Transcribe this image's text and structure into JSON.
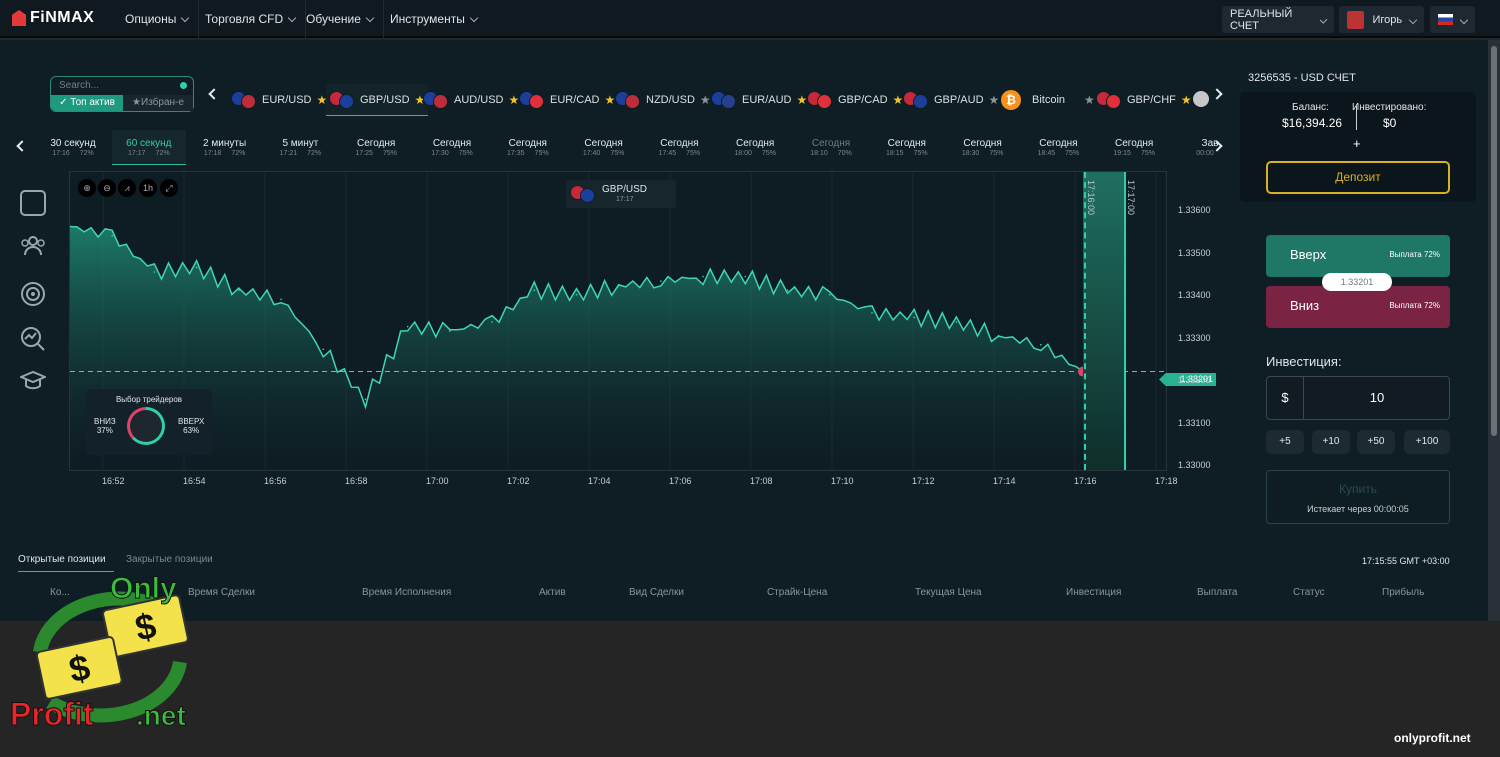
{
  "brand": "FiNMAX",
  "nav": [
    "Опционы",
    "Торговля CFD",
    "Обучение",
    "Инструменты"
  ],
  "account_type": "РЕАЛЬНЫЙ СЧЕТ",
  "user_name": "Игорь",
  "search": {
    "placeholder": "Search...",
    "tab_top": "Топ актив",
    "tab_fav": "Избран-е"
  },
  "pairs": [
    {
      "label": "EUR/USD",
      "star": "gold"
    },
    {
      "label": "GBP/USD",
      "star": "gold",
      "active": true
    },
    {
      "label": "AUD/USD",
      "star": "gold"
    },
    {
      "label": "EUR/CAD",
      "star": "gold"
    },
    {
      "label": "NZD/USD",
      "star": "grey"
    },
    {
      "label": "EUR/AUD",
      "star": "gold"
    },
    {
      "label": "GBP/CAD",
      "star": "gold"
    },
    {
      "label": "GBP/AUD",
      "star": "grey"
    },
    {
      "label": "Bitcoin",
      "star": "grey"
    },
    {
      "label": "GBP/CHF",
      "star": "gold"
    }
  ],
  "expiries": [
    {
      "label": "30 секунд",
      "time": "17:16",
      "pct": "72%"
    },
    {
      "label": "60 секунд",
      "time": "17:17",
      "pct": "72%",
      "active": true
    },
    {
      "label": "2 минуты",
      "time": "17:18",
      "pct": "72%"
    },
    {
      "label": "5 минут",
      "time": "17:21",
      "pct": "72%"
    },
    {
      "label": "Сегодня",
      "time": "17:25",
      "pct": "75%"
    },
    {
      "label": "Сегодня",
      "time": "17:30",
      "pct": "75%"
    },
    {
      "label": "Сегодня",
      "time": "17:35",
      "pct": "75%"
    },
    {
      "label": "Сегодня",
      "time": "17:40",
      "pct": "75%"
    },
    {
      "label": "Сегодня",
      "time": "17:45",
      "pct": "75%"
    },
    {
      "label": "Сегодня",
      "time": "18:00",
      "pct": "75%"
    },
    {
      "label": "Сегодня",
      "time": "18:10",
      "pct": "70%",
      "dim": true
    },
    {
      "label": "Сегодня",
      "time": "18:15",
      "pct": "75%"
    },
    {
      "label": "Сегодня",
      "time": "18:30",
      "pct": "75%"
    },
    {
      "label": "Сегодня",
      "time": "18:45",
      "pct": "75%"
    },
    {
      "label": "Сегодня",
      "time": "19:15",
      "pct": "75%"
    },
    {
      "label": "Зав",
      "time": "00:00",
      "pct": ""
    }
  ],
  "chart": {
    "asset": "GBP/USD",
    "asset_time": "17:17",
    "zoom_label": "1h",
    "prices": [
      "1.33600",
      "1.33500",
      "1.33400",
      "1.33300",
      "1.33200",
      "1.33100",
      "1.33000"
    ],
    "current_price": "1.33201",
    "times": [
      "16:52",
      "16:54",
      "16:56",
      "16:58",
      "17:00",
      "17:02",
      "17:04",
      "17:06",
      "17:08",
      "17:10",
      "17:12",
      "17:14",
      "17:16",
      "17:18"
    ],
    "vline1": "17:16:00",
    "vline2": "17:17:00",
    "traders_title": "Выбор трейдеров",
    "down_label": "ВНИЗ",
    "down_pct": "37%",
    "up_label": "ВВЕРХ",
    "up_pct": "63%"
  },
  "chart_data": {
    "type": "area",
    "title": "GBP/USD",
    "x": [
      "16:52",
      "16:53",
      "16:54",
      "16:55",
      "16:56",
      "16:57",
      "16:58",
      "16:59",
      "17:00",
      "17:01",
      "17:02",
      "17:03",
      "17:04",
      "17:05",
      "17:06",
      "17:07",
      "17:08",
      "17:09",
      "17:10",
      "17:11",
      "17:12",
      "17:13",
      "17:14",
      "17:15",
      "17:16"
    ],
    "values": [
      1.3352,
      1.335,
      1.3342,
      1.3343,
      1.3338,
      1.3336,
      1.3325,
      1.3314,
      1.333,
      1.3329,
      1.3331,
      1.3338,
      1.3337,
      1.3339,
      1.334,
      1.3341,
      1.3341,
      1.3338,
      1.3337,
      1.3333,
      1.3332,
      1.3331,
      1.3328,
      1.3326,
      1.33201
    ],
    "ylim": [
      1.3298,
      1.3364
    ]
  },
  "account": {
    "id": "3256535 - USD СЧЕТ",
    "balance_label": "Баланс:",
    "balance": "$16,394.26",
    "invested_label": "Инвестировано:",
    "invested": "$0",
    "plus": "+",
    "deposit": "Депозит"
  },
  "trade": {
    "up": "Вверх",
    "up_payout": "Выплата 72%",
    "down": "Вниз",
    "down_payout": "Выплата 72%",
    "strike": "1.33201",
    "invest_label": "Инвестиция:",
    "currency": "$",
    "amount": "10",
    "quick": [
      "+5",
      "+10",
      "+50",
      "+100"
    ],
    "buy": "Купить",
    "expires": "Истекает через  00:00:05"
  },
  "positions": {
    "tab_open": "Открытые позиции",
    "tab_closed": "Закрытые позиции",
    "clock": "17:15:55 GMT +03:00",
    "columns": [
      "Ко...",
      "Время Сделки",
      "Время Исполнения",
      "Актив",
      "Вид Сделки",
      "Страйк-Цена",
      "Текущая Цена",
      "Инвестиция",
      "Выплата",
      "Статус",
      "Прибыль"
    ]
  },
  "watermark": {
    "only": "Only",
    "profit": "Profit",
    "net": ".net",
    "site": "onlyprofit.net"
  }
}
